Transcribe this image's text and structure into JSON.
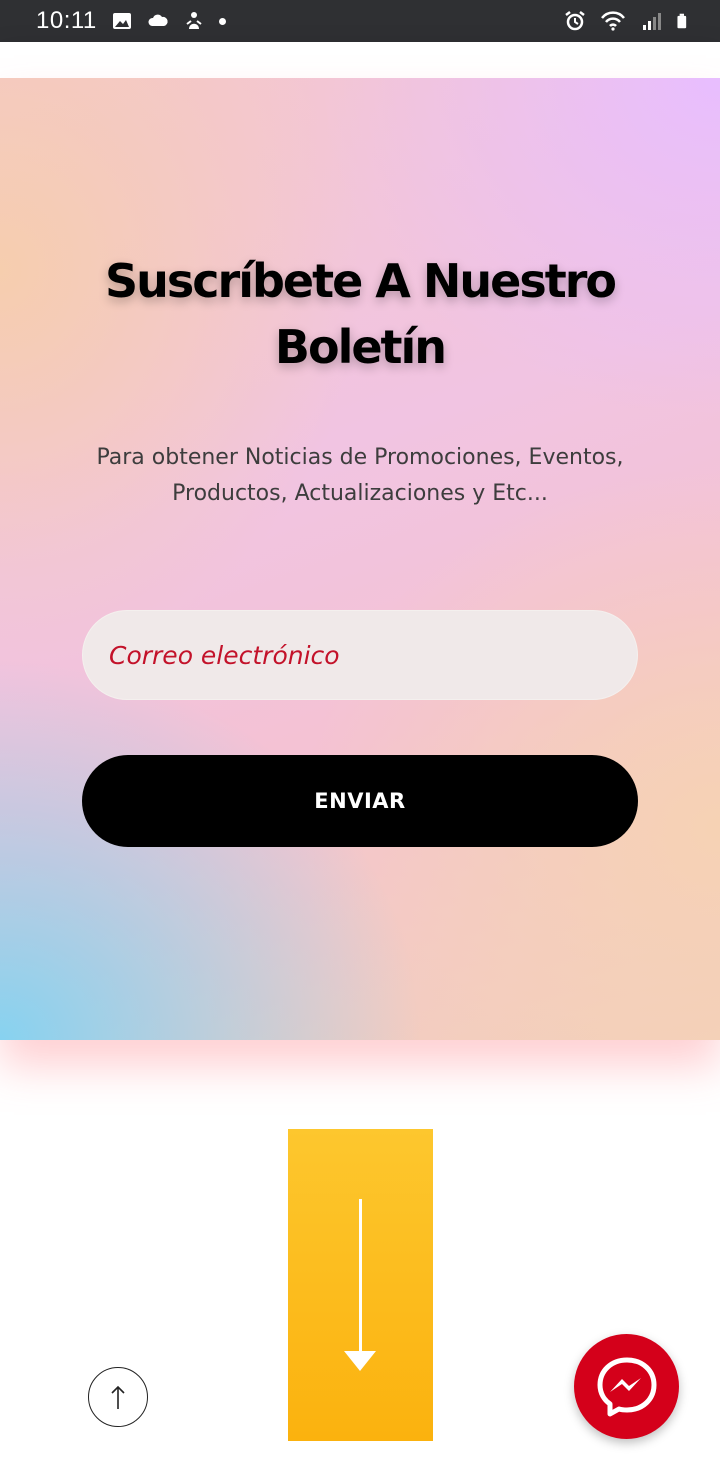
{
  "status_bar": {
    "time": "10:11",
    "left_icons": [
      "image-icon",
      "cloud-icon",
      "person-icon",
      "notification-dot"
    ],
    "right_icons": [
      "alarm-icon",
      "wifi-icon",
      "signal-icon",
      "battery-icon"
    ]
  },
  "newsletter": {
    "title": "Suscríbete A Nuestro Boletín",
    "subtitle": "Para obtener Noticias de  Promociones, Eventos, Productos, Actualizaciones y Etc...",
    "email_placeholder": "Correo electrónico",
    "email_value": "",
    "submit_label": "ENVIAR"
  },
  "floating": {
    "scroll_top_icon": "arrow-up-icon",
    "messenger_icon": "messenger-icon",
    "banner_icon": "arrow-down-icon"
  },
  "colors": {
    "status_bar": "#2f3033",
    "button": "#000000",
    "placeholder": "#c3122a",
    "banner": "#fbb20e",
    "messenger": "#d4001a"
  }
}
